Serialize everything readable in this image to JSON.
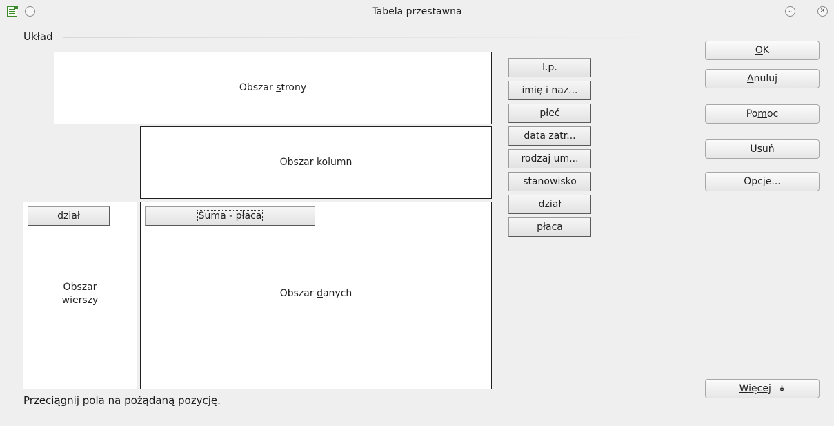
{
  "window": {
    "title": "Tabela przestawna"
  },
  "layout": {
    "group_label": "Układ",
    "page_area": {
      "before": "Obszar ",
      "mnemonic": "s",
      "after": "trony"
    },
    "column_area": {
      "before": "Obszar ",
      "mnemonic": "k",
      "after": "olumn"
    },
    "row_area": {
      "line1": "Obszar",
      "line2_before": "wiersz",
      "line2_mnemonic": "y"
    },
    "data_area": {
      "before": "Obszar ",
      "mnemonic": "d",
      "after": "anych"
    },
    "row_fields": [
      "dział"
    ],
    "data_fields": [
      "Suma - płaca"
    ]
  },
  "field_list": [
    "l.p.",
    "imię i naz...",
    "płeć",
    "data zatr...",
    "rodzaj um...",
    "stanowisko",
    "dział",
    "płaca"
  ],
  "buttons": {
    "ok": {
      "mnemonic": "O",
      "rest": "K"
    },
    "cancel": {
      "mnemonic": "A",
      "rest": "nuluj"
    },
    "help": {
      "before": "Po",
      "mnemonic": "m",
      "after": "oc"
    },
    "remove": {
      "mnemonic": "U",
      "rest": "suń"
    },
    "options": {
      "before": "Opc",
      "mnemonic": "j",
      "after": "e..."
    },
    "more": {
      "before": "W",
      "mnemonic": "i",
      "after": "ęcej",
      "arrow": "¥"
    }
  },
  "status": "Przeciągnij pola na pożądaną pozycję."
}
